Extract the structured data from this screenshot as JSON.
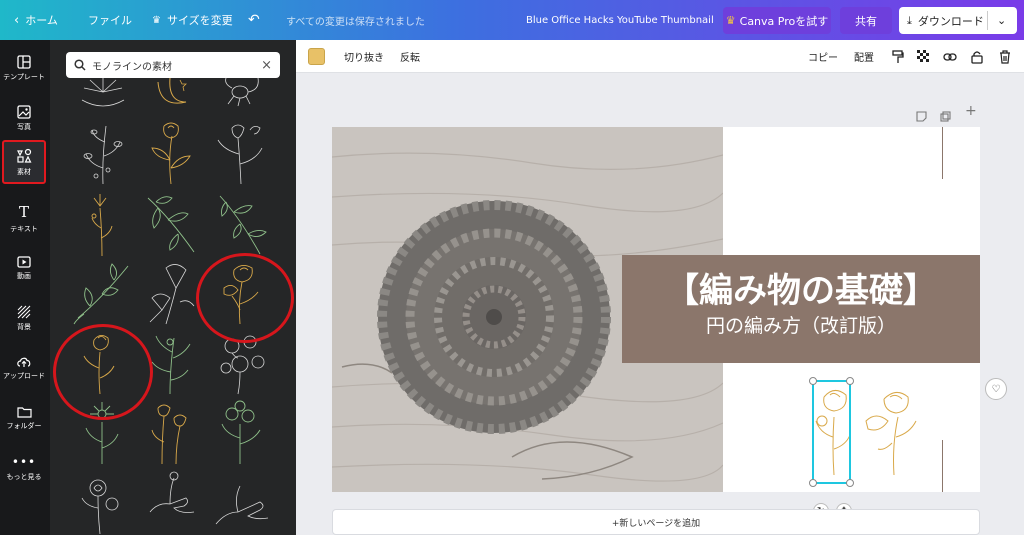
{
  "topbar": {
    "home": "ホーム",
    "file": "ファイル",
    "resize": "サイズを変更",
    "saved_status": "すべての変更は保存されました",
    "doc_title": "Blue Office Hacks YouTube Thumbnail",
    "pro": "Canva Proを試す",
    "share": "共有",
    "download": "ダウンロード"
  },
  "rail": [
    {
      "label": "テンプレート",
      "icon": "template-icon"
    },
    {
      "label": "写真",
      "icon": "photo-icon"
    },
    {
      "label": "素材",
      "icon": "elements-icon"
    },
    {
      "label": "テキスト",
      "icon": "text-icon"
    },
    {
      "label": "動画",
      "icon": "video-icon"
    },
    {
      "label": "背景",
      "icon": "background-icon"
    },
    {
      "label": "アップロード",
      "icon": "upload-icon"
    },
    {
      "label": "フォルダー",
      "icon": "folder-icon"
    },
    {
      "label": "もっと見る",
      "icon": "more-icon"
    }
  ],
  "search": {
    "value": "モノラインの素材"
  },
  "toolbar": {
    "color_swatch": "#e8c167",
    "crop": "切り抜き",
    "flip": "反転",
    "copy": "コピー",
    "arrange": "配置"
  },
  "page": {
    "title": "【編み物の基礎】",
    "subtitle": "円の編み方（改訂版）"
  },
  "add_page": "+新しいページを追加",
  "colors": {
    "gold": "#d9a94a",
    "line_white": "#d8d8d8",
    "line_green": "#8fc08a",
    "highlight": "#d6161c",
    "select": "#1ec7e0"
  }
}
